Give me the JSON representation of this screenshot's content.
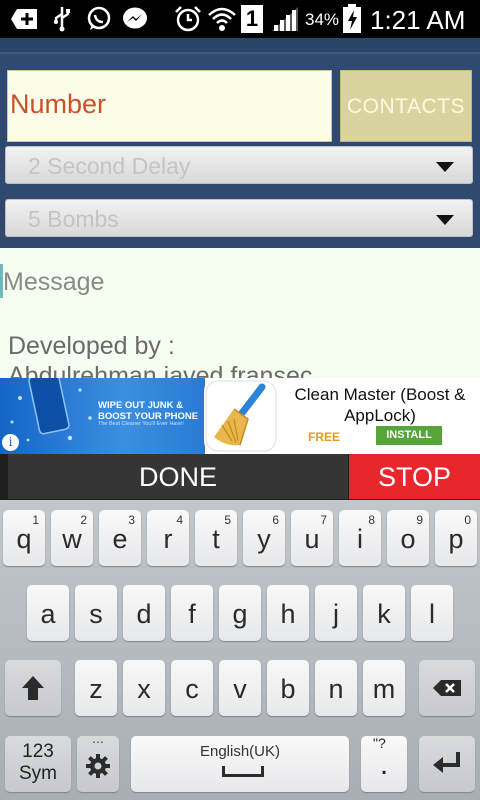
{
  "status_bar": {
    "battery": "34%",
    "signal": "1",
    "time": "1:21 AM"
  },
  "form": {
    "number_placeholder": "Number",
    "contacts_label": "CONTACTS",
    "delay_selected": "2 Second Delay",
    "bombs_selected": "5  Bombs",
    "message_placeholder": "Message",
    "developer_line1": "Developed by :",
    "developer_line2": "Abdulrehman javed fransec"
  },
  "ad": {
    "banner_line1": "WIPE OUT JUNK &",
    "banner_line2": "BOOST YOUR PHONE",
    "banner_sub": "The Best Cleaner You'll Ever Have!",
    "title": "Clean Master (Boost & AppLock)",
    "price": "FREE",
    "install_label": "INSTALL",
    "info": "i"
  },
  "actions": {
    "done_label": "DONE",
    "stop_label": "STOP"
  },
  "keyboard": {
    "row1": [
      {
        "ch": "q",
        "num": "1"
      },
      {
        "ch": "w",
        "num": "2"
      },
      {
        "ch": "e",
        "num": "3"
      },
      {
        "ch": "r",
        "num": "4"
      },
      {
        "ch": "t",
        "num": "5"
      },
      {
        "ch": "y",
        "num": "6"
      },
      {
        "ch": "u",
        "num": "7"
      },
      {
        "ch": "i",
        "num": "8"
      },
      {
        "ch": "o",
        "num": "9"
      },
      {
        "ch": "p",
        "num": "0"
      }
    ],
    "row2": [
      "a",
      "s",
      "d",
      "f",
      "g",
      "h",
      "j",
      "k",
      "l"
    ],
    "row3": [
      "z",
      "x",
      "c",
      "v",
      "b",
      "n",
      "m"
    ],
    "sym_label_line1": "123",
    "sym_label_line2": "Sym",
    "language_label": "English(UK)",
    "period_label": ".",
    "period_alt": "\"?",
    "gear_alt": "..."
  }
}
